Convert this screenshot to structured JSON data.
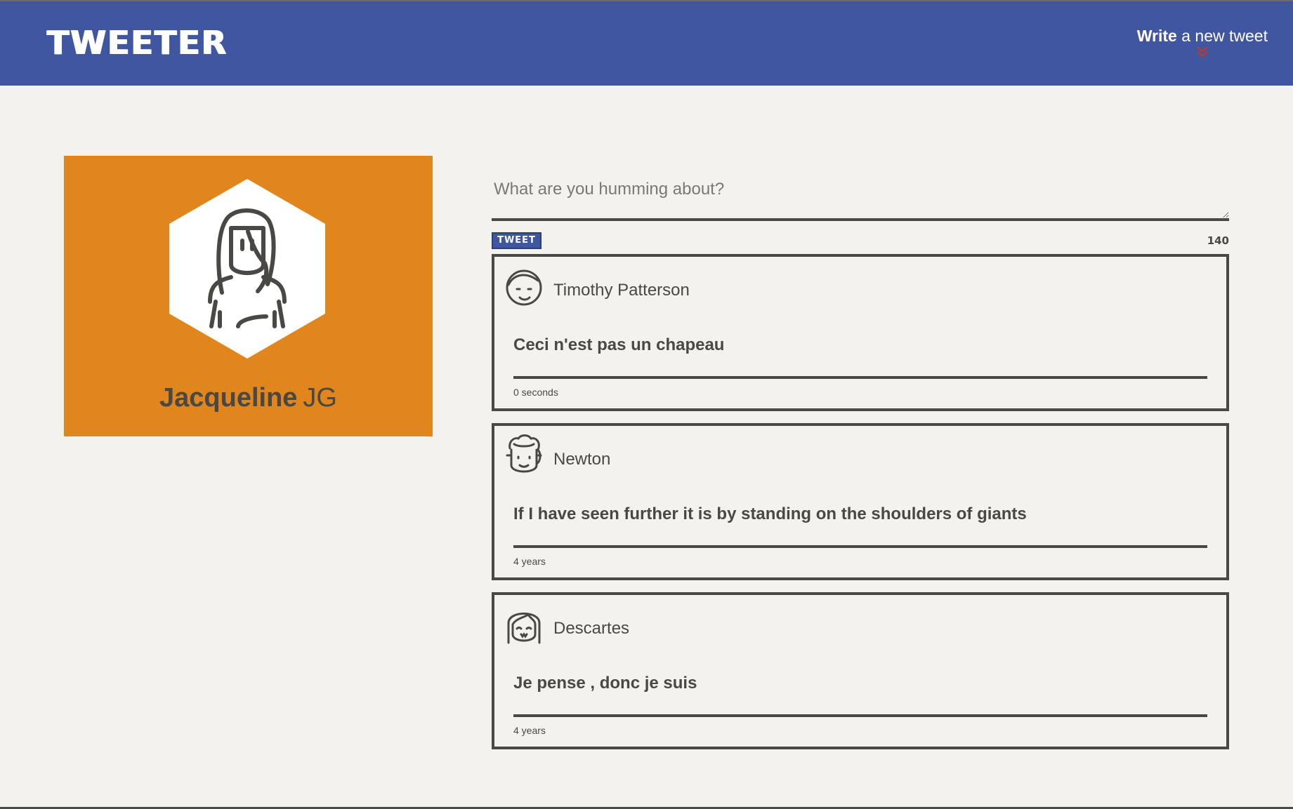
{
  "nav": {
    "logo": "TWEETER",
    "compose_bold": "Write",
    "compose_rest": " a new tweet",
    "chevron_icon": "double-chevron-down-icon",
    "chevron_color": "#c0392b"
  },
  "profile": {
    "first_name": "Jacqueline",
    "handle": "JG",
    "avatar_icon": "woman-avatar-icon",
    "card_color": "#e0861c"
  },
  "compose": {
    "placeholder": "What are you humming about?",
    "tweet_button": "TWEET",
    "counter": "140"
  },
  "tweets": [
    {
      "author": "Timothy Patterson",
      "avatar_icon": "smiling-man-avatar-icon",
      "content": "Ceci n'est pas un chapeau",
      "time": "0 seconds"
    },
    {
      "author": "Newton",
      "avatar_icon": "curly-hair-man-avatar-icon",
      "content": "If I have seen further it is by standing on the shoulders of giants",
      "time": "4 years"
    },
    {
      "author": "Descartes",
      "avatar_icon": "bob-hair-avatar-icon",
      "content": "Je pense , donc je suis",
      "time": "4 years"
    }
  ],
  "colors": {
    "nav_bg": "#4056a1",
    "page_bg": "#f4f2ed",
    "text": "#4a4844"
  }
}
